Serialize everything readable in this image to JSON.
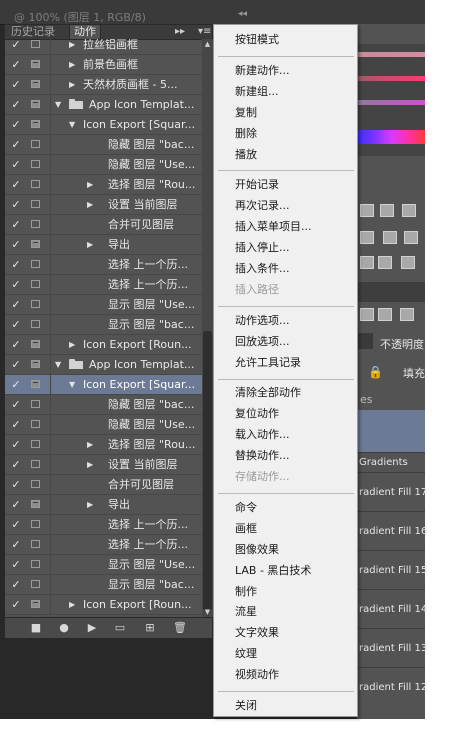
{
  "window": {
    "doc_title": "@ 100% (图层 1, RGB/8)",
    "collapse_glyph": "◂◂"
  },
  "actions_panel": {
    "tabs": [
      {
        "label": "历史记录"
      },
      {
        "label": "动作"
      }
    ],
    "overflow_glyph": "▸▸",
    "menu_glyph": "▾≡",
    "rows": [
      {
        "checked": true,
        "dialog": false,
        "type": "action",
        "expand": "collapsed",
        "label": "拉丝铝画框"
      },
      {
        "checked": true,
        "dialog": true,
        "type": "action",
        "expand": "collapsed",
        "label": "前景色画框"
      },
      {
        "checked": true,
        "dialog": true,
        "type": "action",
        "expand": "collapsed",
        "label": "天然材质画框 - 5..."
      },
      {
        "checked": true,
        "dialog": true,
        "type": "set",
        "expand": "expanded",
        "label": "App Icon Templat..."
      },
      {
        "checked": true,
        "dialog": true,
        "type": "action",
        "expand": "expanded",
        "label": "Icon Export [Squar..."
      },
      {
        "checked": true,
        "dialog": false,
        "type": "command",
        "expand": "none",
        "label": "隐藏 图层 \"bac..."
      },
      {
        "checked": true,
        "dialog": false,
        "type": "command",
        "expand": "none",
        "label": "隐藏 图层 \"Use..."
      },
      {
        "checked": true,
        "dialog": false,
        "type": "command",
        "expand": "collapsed",
        "label": "选择 图层 \"Rou..."
      },
      {
        "checked": true,
        "dialog": false,
        "type": "command",
        "expand": "collapsed",
        "label": "设置 当前图层"
      },
      {
        "checked": true,
        "dialog": false,
        "type": "command",
        "expand": "none",
        "label": "合并可见图层"
      },
      {
        "checked": true,
        "dialog": true,
        "type": "command",
        "expand": "collapsed",
        "label": "导出"
      },
      {
        "checked": true,
        "dialog": false,
        "type": "command",
        "expand": "none",
        "label": "选择 上一个历..."
      },
      {
        "checked": true,
        "dialog": false,
        "type": "command",
        "expand": "none",
        "label": "选择 上一个历..."
      },
      {
        "checked": true,
        "dialog": false,
        "type": "command",
        "expand": "none",
        "label": "显示 图层 \"Use..."
      },
      {
        "checked": true,
        "dialog": false,
        "type": "command",
        "expand": "none",
        "label": "显示 图层 \"bac..."
      },
      {
        "checked": true,
        "dialog": true,
        "type": "action",
        "expand": "collapsed",
        "label": "Icon Export [Roun..."
      },
      {
        "checked": true,
        "dialog": true,
        "type": "set",
        "expand": "expanded",
        "label": "App Icon Templat..."
      },
      {
        "checked": true,
        "dialog": true,
        "type": "action",
        "expand": "expanded",
        "label": "Icon Export [Squar...",
        "selected": true
      },
      {
        "checked": true,
        "dialog": false,
        "type": "command",
        "expand": "none",
        "label": "隐藏 图层 \"bac..."
      },
      {
        "checked": true,
        "dialog": false,
        "type": "command",
        "expand": "none",
        "label": "隐藏 图层 \"Use..."
      },
      {
        "checked": true,
        "dialog": false,
        "type": "command",
        "expand": "collapsed",
        "label": "选择 图层 \"Rou..."
      },
      {
        "checked": true,
        "dialog": false,
        "type": "command",
        "expand": "collapsed",
        "label": "设置 当前图层"
      },
      {
        "checked": true,
        "dialog": false,
        "type": "command",
        "expand": "none",
        "label": "合并可见图层"
      },
      {
        "checked": true,
        "dialog": true,
        "type": "command",
        "expand": "collapsed",
        "label": "导出"
      },
      {
        "checked": true,
        "dialog": false,
        "type": "command",
        "expand": "none",
        "label": "选择 上一个历..."
      },
      {
        "checked": true,
        "dialog": false,
        "type": "command",
        "expand": "none",
        "label": "选择 上一个历..."
      },
      {
        "checked": true,
        "dialog": false,
        "type": "command",
        "expand": "none",
        "label": "显示 图层 \"Use..."
      },
      {
        "checked": true,
        "dialog": false,
        "type": "command",
        "expand": "none",
        "label": "显示 图层 \"bac..."
      },
      {
        "checked": true,
        "dialog": true,
        "type": "action",
        "expand": "collapsed",
        "label": "Icon Export [Roun..."
      }
    ],
    "bottom_buttons": [
      {
        "name": "stop-recording-button",
        "glyph": "■"
      },
      {
        "name": "start-recording-button",
        "glyph": "●"
      },
      {
        "name": "play-selection-button",
        "glyph": "▶"
      },
      {
        "name": "new-set-button",
        "glyph": "▭"
      },
      {
        "name": "new-action-button",
        "glyph": "⊞"
      },
      {
        "name": "delete-button",
        "glyph": "🗑"
      }
    ]
  },
  "right_panels": {
    "opacity_label": "不透明度",
    "lock_glyph": "🔒",
    "fill_label": "填充",
    "layers_header": "es",
    "layers": [
      "Gradients",
      "radient Fill 17",
      "radient Fill 16",
      "radient Fill 15",
      "radient Fill 14",
      "radient Fill 13",
      "radient Fill 12"
    ]
  },
  "menu": {
    "groups": [
      {
        "items": [
          {
            "label": "按钮模式"
          }
        ]
      },
      {
        "items": [
          {
            "label": "新建动作..."
          },
          {
            "label": "新建组..."
          },
          {
            "label": "复制"
          },
          {
            "label": "删除"
          },
          {
            "label": "播放"
          }
        ]
      },
      {
        "items": [
          {
            "label": "开始记录"
          },
          {
            "label": "再次记录..."
          },
          {
            "label": "插入菜单项目..."
          },
          {
            "label": "插入停止..."
          },
          {
            "label": "插入条件..."
          },
          {
            "label": "插入路径",
            "disabled": true
          }
        ]
      },
      {
        "items": [
          {
            "label": "动作选项..."
          },
          {
            "label": "回放选项..."
          },
          {
            "label": "允许工具记录"
          }
        ]
      },
      {
        "items": [
          {
            "label": "清除全部动作"
          },
          {
            "label": "复位动作"
          },
          {
            "label": "载入动作..."
          },
          {
            "label": "替换动作..."
          },
          {
            "label": "存储动作...",
            "disabled": true
          }
        ]
      },
      {
        "items": [
          {
            "label": "命令"
          },
          {
            "label": "画框"
          },
          {
            "label": "图像效果"
          },
          {
            "label": "LAB - 黑白技术"
          },
          {
            "label": "制作"
          },
          {
            "label": "流星"
          },
          {
            "label": "文字效果"
          },
          {
            "label": "纹理"
          },
          {
            "label": "视频动作"
          }
        ]
      },
      {
        "items": [
          {
            "label": "关闭"
          }
        ]
      }
    ]
  }
}
